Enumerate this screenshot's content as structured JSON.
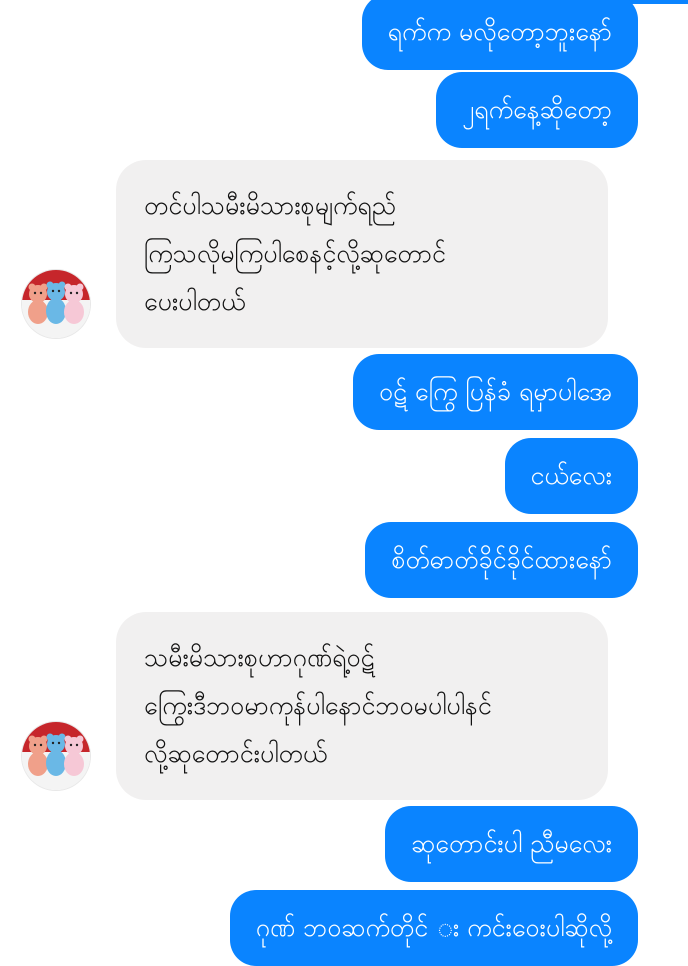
{
  "conversation": {
    "messages": [
      {
        "sender": "me",
        "text": "ရက်က မလိုတော့ဘူးနော်"
      },
      {
        "sender": "me",
        "text": "၂ရက်နေ့ဆိုတော့"
      },
      {
        "sender": "contact",
        "lines": [
          "တင်ပါသမီးမိသားစုမျက်ရည်",
          "ကြသလိုမကြပါစေနင့်လို့ဆုတောင်",
          "ပေးပါတယ်"
        ]
      },
      {
        "sender": "me",
        "text": "ဝဋ် ကြွေ ပြန်ခံ ရမှာပါအေ"
      },
      {
        "sender": "me",
        "text": "ငယ်လေး"
      },
      {
        "sender": "me",
        "text": "စိတ်ဓာတ်ခိုင်ခိုင်ထားနော်"
      },
      {
        "sender": "contact",
        "lines": [
          "သမီးမိသားစုဟာဂုဏ်ရဲ့ဝဋ်",
          "ကြွေးဒီဘဝမာကုန်ပါနောင်ဘဝမပါပါနင်",
          "လို့ဆုတောင်းပါတယ်"
        ]
      },
      {
        "sender": "me",
        "text": "ဆုတောင်းပါ ညီမလေး"
      },
      {
        "sender": "me",
        "text": "ဂုဏ် ဘဝဆက်တိုင် း ကင်းဝေးပါဆိုလို့"
      }
    ],
    "avatar": {
      "icon": "teddy-bears-avatar-icon"
    },
    "colors": {
      "outgoing_bubble": "#0a84ff",
      "incoming_bubble": "#f1f0f0",
      "background": "#ffffff"
    }
  }
}
